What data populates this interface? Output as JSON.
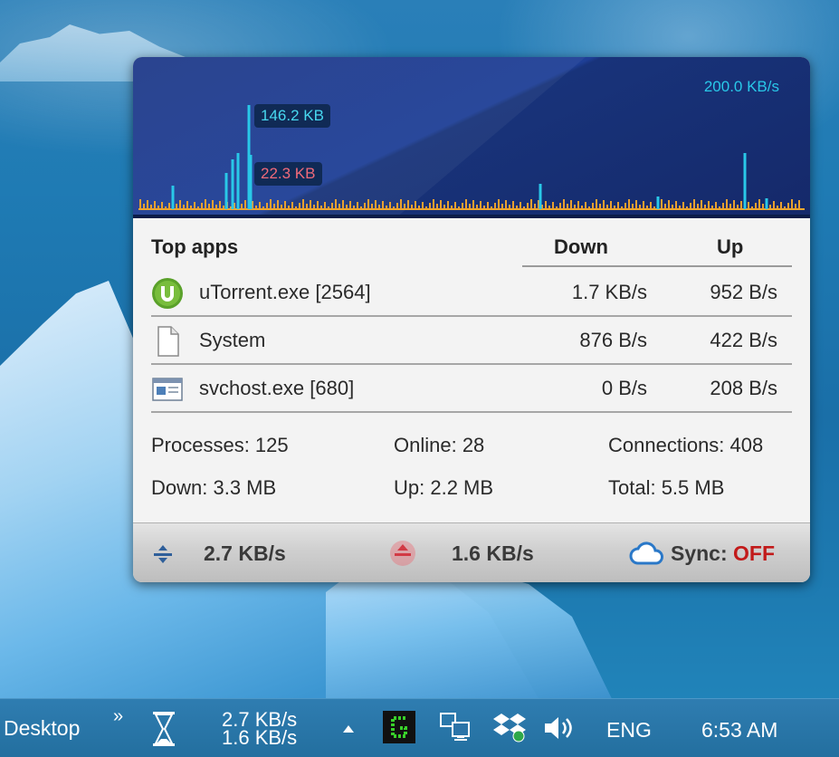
{
  "graph": {
    "scale": "200.0 KB/s",
    "peak_down": "146.2 KB",
    "peak_up": "22.3 KB",
    "colors": {
      "down": "#29c8e8",
      "up": "#e8a030",
      "peak_up_text": "#f06a7a"
    }
  },
  "table": {
    "headers": {
      "apps": "Top apps",
      "down": "Down",
      "up": "Up"
    },
    "rows": [
      {
        "icon": "utorrent-icon",
        "name": "uTorrent.exe [2564]",
        "down": "1.7 KB/s",
        "up": "952 B/s"
      },
      {
        "icon": "file-icon",
        "name": "System",
        "down": "876 B/s",
        "up": "422 B/s"
      },
      {
        "icon": "window-icon",
        "name": "svchost.exe [680]",
        "down": "0 B/s",
        "up": "208 B/s"
      }
    ]
  },
  "stats": {
    "processes": "Processes: 125",
    "online": "Online: 28",
    "connections": "Connections: 408",
    "down_total": "Down: 3.3 MB",
    "up_total": "Up: 2.2 MB",
    "total": "Total: 5.5 MB"
  },
  "bottom_bar": {
    "down_speed": "2.7 KB/s",
    "up_speed": "1.6 KB/s",
    "sync_label": "Sync:",
    "sync_state": "OFF"
  },
  "taskbar": {
    "desktop_label": "Desktop",
    "chevron": "»",
    "speed_down": "2.7 KB/s",
    "speed_up": "1.6 KB/s",
    "language": "ENG",
    "time": "6:53 AM"
  }
}
